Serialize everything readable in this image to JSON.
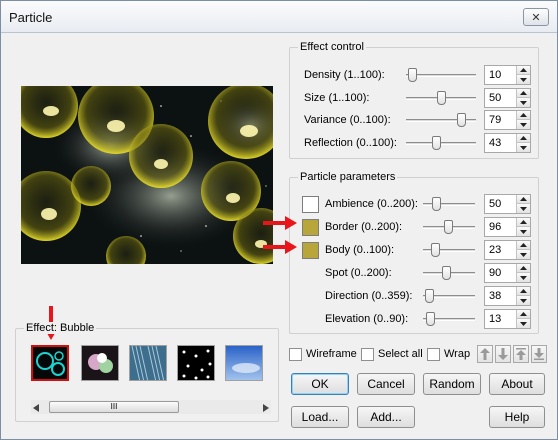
{
  "window": {
    "title": "Particle",
    "close_label": "✕"
  },
  "effect_control": {
    "title": "Effect control",
    "rows": [
      {
        "label": "Density (1..100):",
        "value": "10"
      },
      {
        "label": "Size (1..100):",
        "value": "50"
      },
      {
        "label": "Variance (0..100):",
        "value": "79"
      },
      {
        "label": "Reflection (0..100):",
        "value": "43"
      }
    ]
  },
  "particle_parameters": {
    "title": "Particle parameters",
    "rows": [
      {
        "label": "Ambience (0..200):",
        "value": "50",
        "swatch": "#ffffff"
      },
      {
        "label": "Border (0..200):",
        "value": "96",
        "swatch": "#b8a63a"
      },
      {
        "label": "Body (0..100):",
        "value": "23",
        "swatch": "#b8a63a"
      },
      {
        "label": "Spot (0..200):",
        "value": "90"
      },
      {
        "label": "Direction (0..359):",
        "value": "38"
      },
      {
        "label": "Elevation (0..90):",
        "value": "13"
      }
    ]
  },
  "effect_bubble": {
    "title": "Effect: Bubble",
    "scroll_grip": "III"
  },
  "options": {
    "wireframe": "Wireframe",
    "select_all": "Select all",
    "wrap": "Wrap"
  },
  "buttons": {
    "ok": "OK",
    "cancel": "Cancel",
    "random": "Random",
    "about": "About",
    "load": "Load...",
    "add": "Add...",
    "help": "Help"
  },
  "colors": {
    "accent": "#3c7fb1",
    "highlight_red": "#e8151b",
    "gold": "#b8a63a"
  }
}
